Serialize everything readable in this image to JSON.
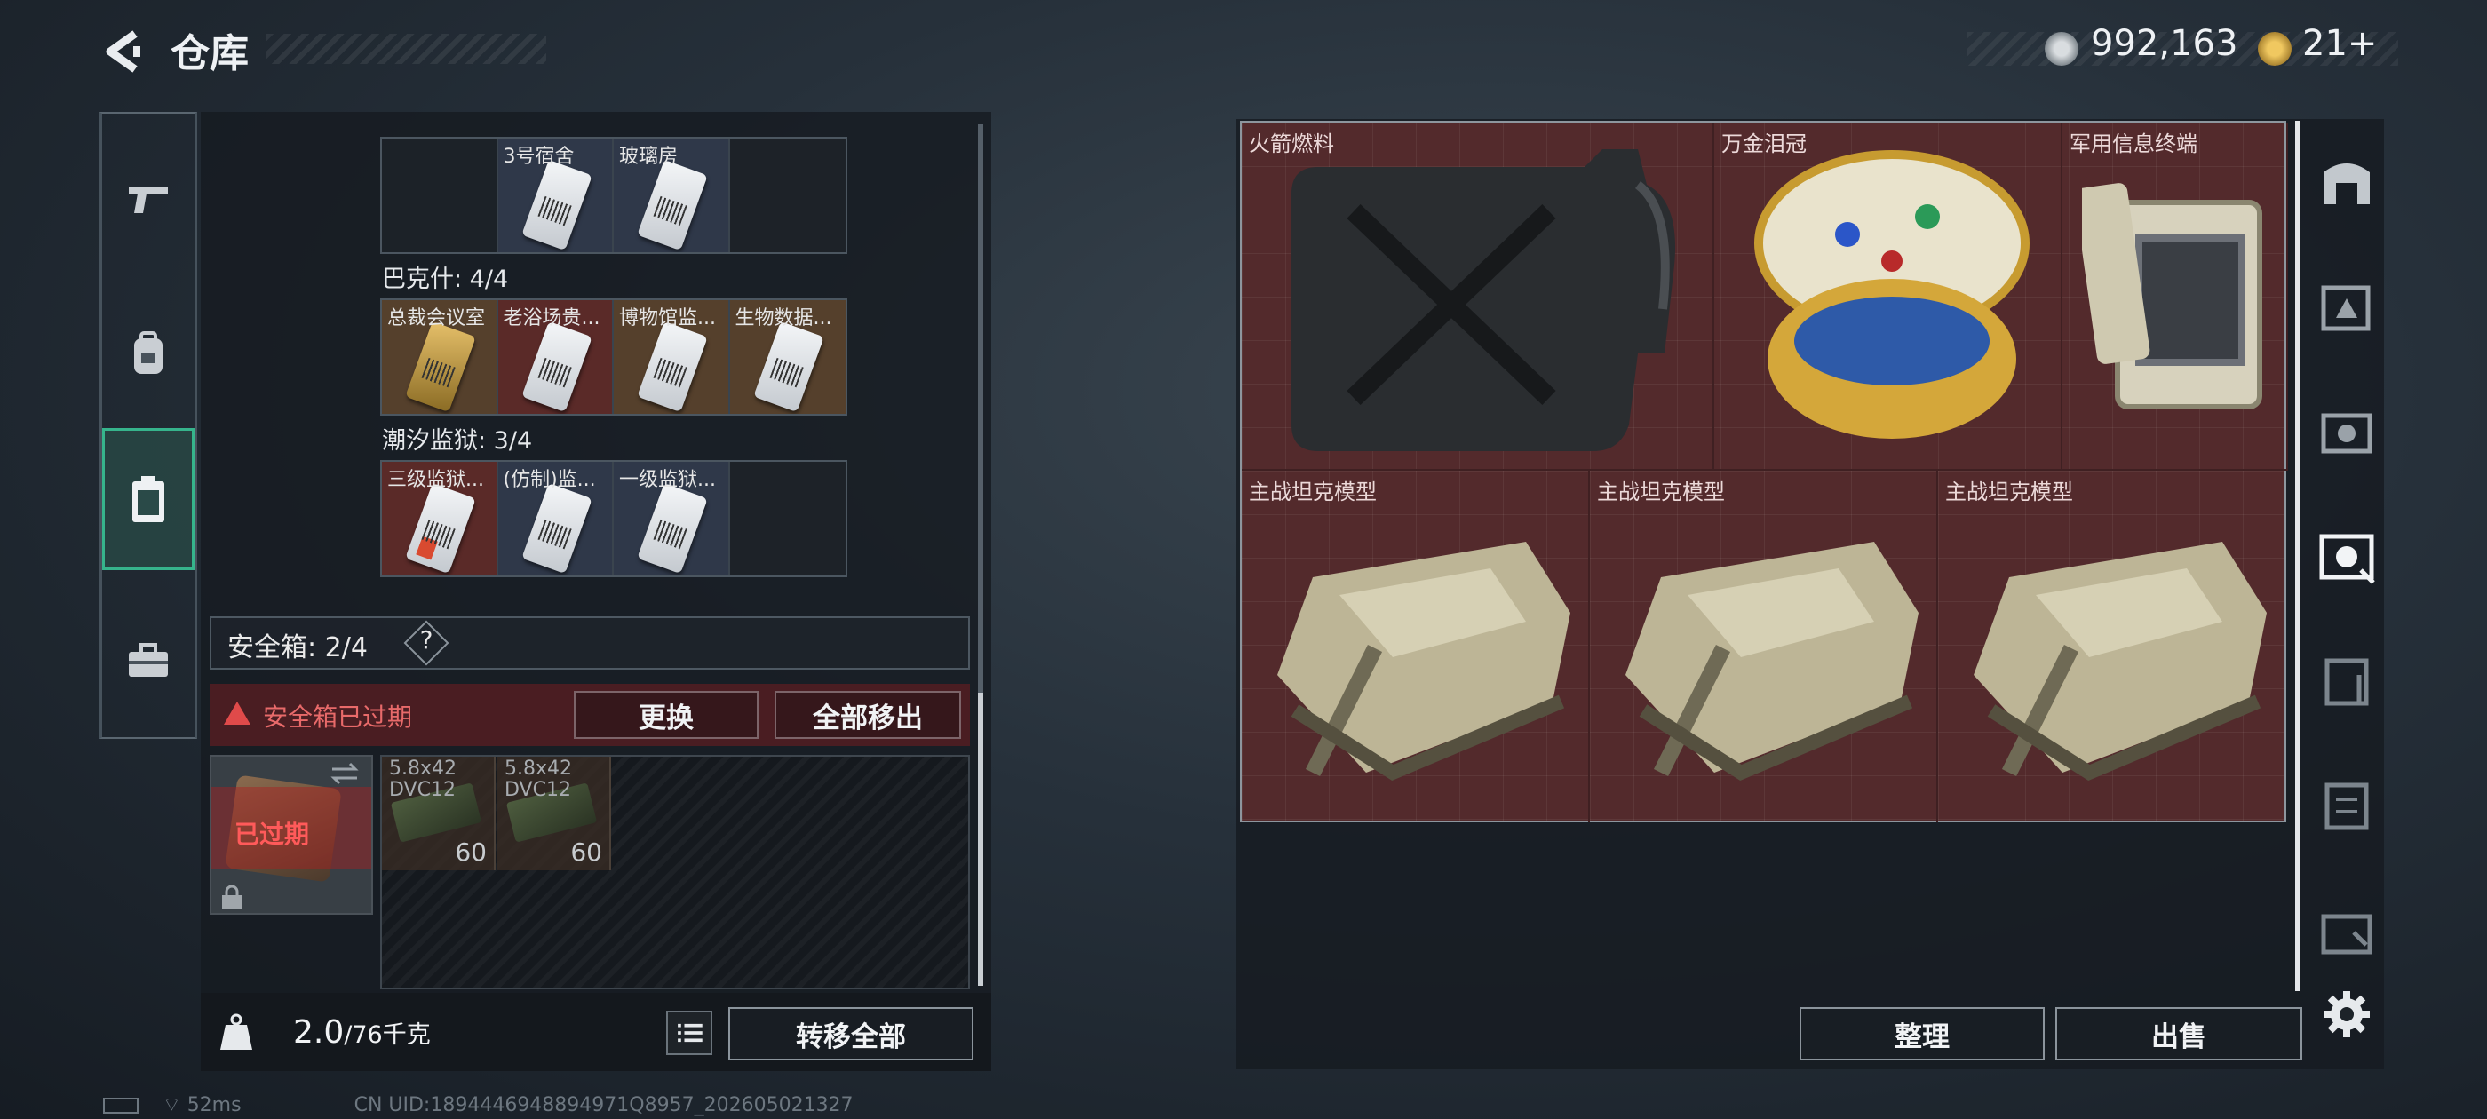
{
  "header": {
    "title": "仓库",
    "currency_amount": "992,163",
    "tokens": "21+"
  },
  "left_tabs": [
    "gun-icon",
    "backpack-icon",
    "safe-case-icon",
    "toolbox-icon"
  ],
  "keycards": {
    "group1": {
      "items": [
        "",
        "3号宿舍",
        "玻璃房",
        ""
      ]
    },
    "group2": {
      "title": "巴克什: 4/4",
      "items": [
        "总裁会议室",
        "老浴场贵...",
        "博物馆监...",
        "生物数据..."
      ]
    },
    "group3": {
      "title": "潮汐监狱: 3/4",
      "items": [
        "三级监狱...",
        "(仿制)监...",
        "一级监狱...",
        ""
      ]
    }
  },
  "safe_box": {
    "label": "安全箱: 2/4",
    "help": "?",
    "warning": "安全箱已过期",
    "replace_button": "更换",
    "remove_all_button": "全部移出",
    "expired_tag": "已过期",
    "ammo": [
      {
        "line1": "5.8x42",
        "line2": "DVC12",
        "count": "60"
      },
      {
        "line1": "5.8x42",
        "line2": "DVC12",
        "count": "60"
      }
    ]
  },
  "footer": {
    "weight_value": "2.0",
    "weight_max": "/76千克",
    "transfer_all_button": "转移全部"
  },
  "status_bar": {
    "ping": "52ms",
    "uid": "CN UID:1894446948894971Q8957_202605021327"
  },
  "stash_items": [
    {
      "name": "火箭燃料",
      "icon": "fuel-can-icon"
    },
    {
      "name": "万金泪冠",
      "icon": "jeweled-egg-icon"
    },
    {
      "name": "军用信息终端",
      "icon": "terminal-case-icon"
    },
    {
      "name": "主战坦克模型",
      "icon": "tank-model-icon"
    },
    {
      "name": "主战坦克模型",
      "icon": "tank-model-icon"
    },
    {
      "name": "主战坦克模型",
      "icon": "tank-model-icon"
    }
  ],
  "actions": {
    "sort_button": "整理",
    "sell_button": "出售"
  },
  "colors": {
    "accent_green": "#36b48c",
    "expired_red": "#e04a4a",
    "stash_bg": "#532a2c"
  }
}
